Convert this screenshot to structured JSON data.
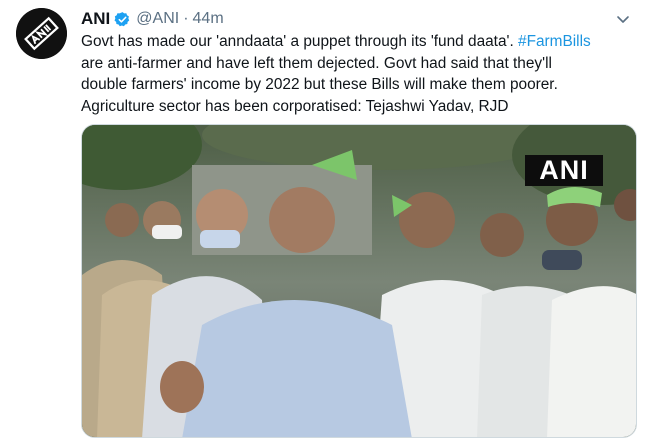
{
  "tweet": {
    "author_name": "ANI",
    "handle": "@ANI",
    "separator": "·",
    "time": "44m",
    "text_lines": [
      {
        "before": "Govt has made our 'anndaata' a puppet through its 'fund daata'. ",
        "hashtag": "#FarmBills"
      },
      {
        "before": "are anti-farmer and have left them dejected. Govt had said that they'll"
      },
      {
        "before": "double farmers' income by 2022 but these Bills will make them poorer."
      },
      {
        "before": "Agriculture sector has been corporatised: Tejashwi Yadav, RJD"
      }
    ],
    "media_watermark": "ANI"
  },
  "icons": {
    "avatar": "ani-logo-avatar",
    "verified": "verified-badge-icon",
    "more": "chevron-down-icon"
  },
  "colors": {
    "link": "#1b95e0",
    "secondary": "#5b7083",
    "verified": "#1da1f2"
  }
}
